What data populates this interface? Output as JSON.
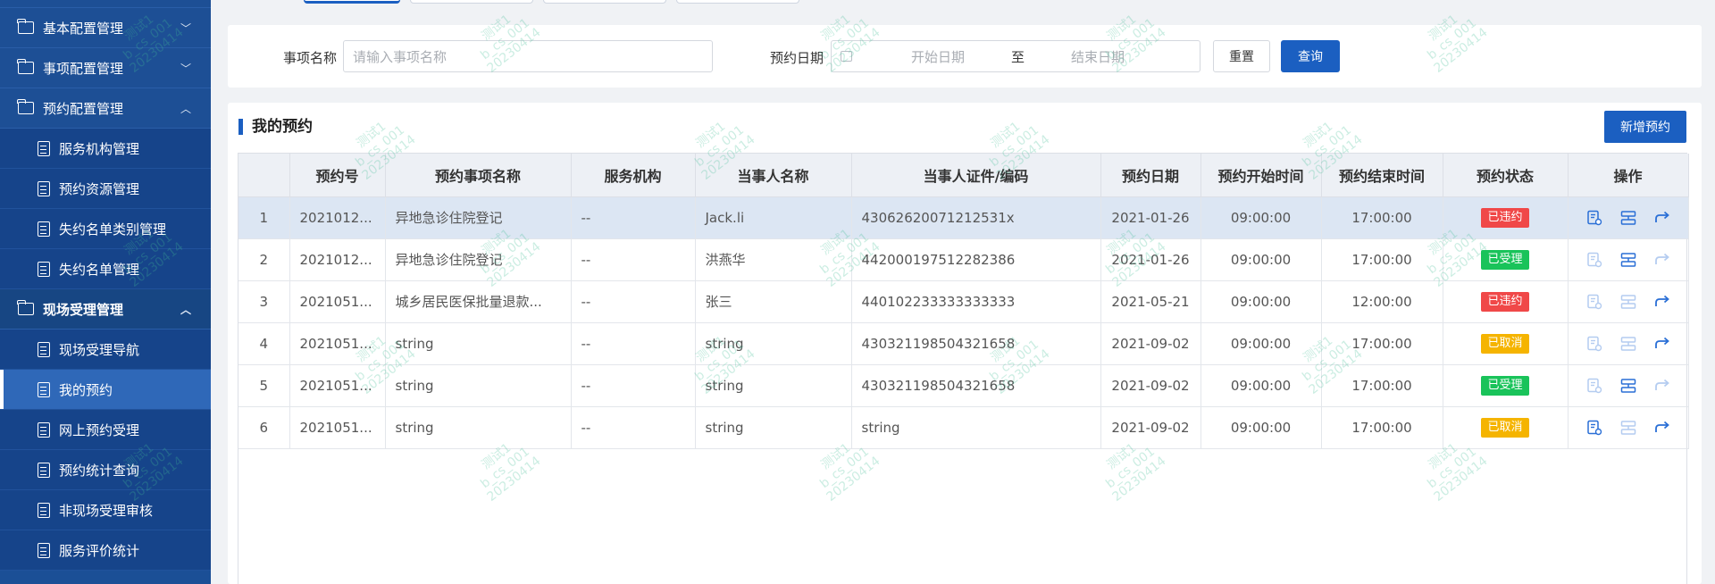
{
  "sidebar": {
    "groups": [
      {
        "label": "基本配置管理",
        "chevron": "﹀"
      },
      {
        "label": "事项配置管理",
        "chevron": "﹀"
      },
      {
        "label": "预约配置管理",
        "chevron": "︿"
      },
      {
        "label": "现场受理管理",
        "chevron": "︿"
      }
    ],
    "items": [
      {
        "label": "服务机构管理"
      },
      {
        "label": "预约资源管理"
      },
      {
        "label": "失约名单类别管理"
      },
      {
        "label": "失约名单管理"
      },
      {
        "label": "现场受理导航"
      },
      {
        "label": "我的预约"
      },
      {
        "label": "网上预约受理"
      },
      {
        "label": "预约统计查询"
      },
      {
        "label": "非现场受理审核"
      },
      {
        "label": "服务评价统计"
      }
    ]
  },
  "search": {
    "item_label": "事项名称",
    "item_placeholder": "请输入事项名称",
    "date_label": "预约日期",
    "start_placeholder": "开始日期",
    "date_sep": "至",
    "end_placeholder": "结束日期",
    "reset_label": "重置",
    "query_label": "查询"
  },
  "panel": {
    "title": "我的预约",
    "add_label": "新增预约"
  },
  "table": {
    "headers": [
      "",
      "预约号",
      "预约事项名称",
      "服务机构",
      "当事人名称",
      "当事人证件/编码",
      "预约日期",
      "预约开始时间",
      "预约结束时间",
      "预约状态",
      "操作"
    ],
    "rows": [
      {
        "idx": "1",
        "no": "2021012...",
        "item": "异地急诊住院登记",
        "org": "--",
        "name": "Jack.li",
        "cert": "43062620071212531x",
        "date": "2021-01-26",
        "start": "09:00:00",
        "end": "17:00:00",
        "status": "已违约",
        "status_color": "#f04848",
        "ops": [
          true,
          true,
          true
        ]
      },
      {
        "idx": "2",
        "no": "2021012...",
        "item": "异地急诊住院登记",
        "org": "--",
        "name": "洪燕华",
        "cert": "442000197512282386",
        "date": "2021-01-26",
        "start": "09:00:00",
        "end": "17:00:00",
        "status": "已受理",
        "status_color": "#19c35a",
        "ops": [
          false,
          true,
          false
        ]
      },
      {
        "idx": "3",
        "no": "2021051...",
        "item": "城乡居民医保批量退款...",
        "org": "--",
        "name": "张三",
        "cert": "440102233333333333",
        "date": "2021-05-21",
        "start": "09:00:00",
        "end": "12:00:00",
        "status": "已违约",
        "status_color": "#f04848",
        "ops": [
          false,
          false,
          true
        ]
      },
      {
        "idx": "4",
        "no": "2021051...",
        "item": "string",
        "org": "--",
        "name": "string",
        "cert": "430321198504321658",
        "date": "2021-09-02",
        "start": "09:00:00",
        "end": "17:00:00",
        "status": "已取消",
        "status_color": "#f5b400",
        "ops": [
          false,
          false,
          true
        ]
      },
      {
        "idx": "5",
        "no": "2021051...",
        "item": "string",
        "org": "--",
        "name": "string",
        "cert": "430321198504321658",
        "date": "2021-09-02",
        "start": "09:00:00",
        "end": "17:00:00",
        "status": "已受理",
        "status_color": "#19c35a",
        "ops": [
          false,
          true,
          false
        ]
      },
      {
        "idx": "6",
        "no": "2021051...",
        "item": "string",
        "org": "--",
        "name": "string",
        "cert": "string",
        "date": "2021-09-02",
        "start": "09:00:00",
        "end": "17:00:00",
        "status": "已取消",
        "status_color": "#f5b400",
        "ops": [
          true,
          false,
          true
        ]
      }
    ]
  },
  "watermark": {
    "text": "测试1\nb_cs_001\n20230414"
  },
  "colors": {
    "sidebar": "#1b4f96",
    "primary": "#1b5fc1",
    "danger": "#f04848",
    "success": "#19c35a",
    "warning": "#f5b400"
  }
}
